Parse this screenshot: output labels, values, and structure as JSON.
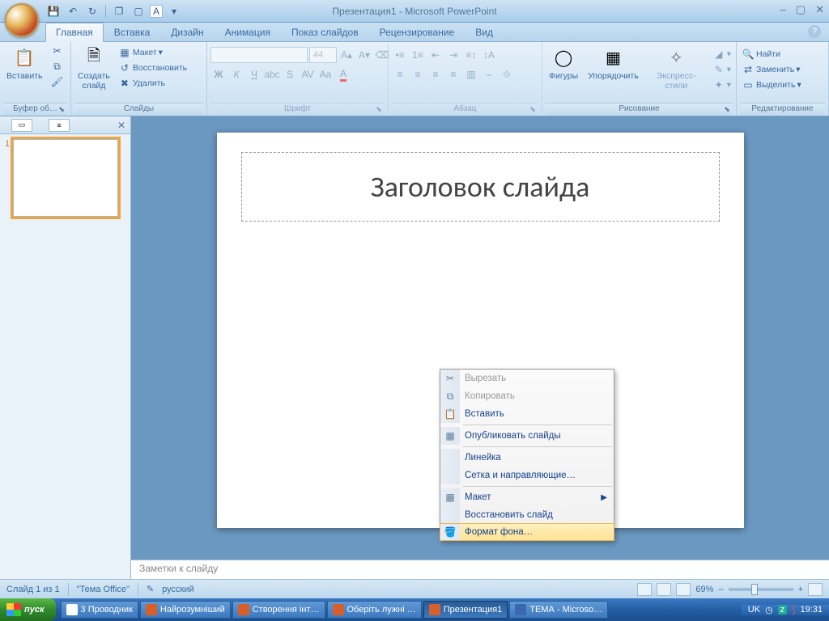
{
  "app_title": "Презентация1 - Microsoft PowerPoint",
  "qat": {
    "save": "💾",
    "undo": "↶",
    "redo": "↻",
    "new": "❐",
    "open": "▢",
    "a": "A"
  },
  "tabs": [
    "Главная",
    "Вставка",
    "Дизайн",
    "Анимация",
    "Показ слайдов",
    "Рецензирование",
    "Вид"
  ],
  "ribbon": {
    "clipboard": {
      "paste": "Вставить",
      "label": "Буфер об…"
    },
    "slides": {
      "new_slide": "Создать\nслайд",
      "layout": "Макет",
      "reset": "Восстановить",
      "delete": "Удалить",
      "label": "Слайды"
    },
    "font": {
      "size": "44",
      "label": "Шрифт"
    },
    "paragraph": {
      "label": "Абзац"
    },
    "drawing": {
      "shapes": "Фигуры",
      "arrange": "Упорядочить",
      "quick_styles": "Экспресс-стили",
      "label": "Рисование"
    },
    "editing": {
      "find": "Найти",
      "replace": "Заменить",
      "select": "Выделить",
      "label": "Редактирование"
    }
  },
  "slide": {
    "title_placeholder": "Заголовок слайда",
    "notes": "Заметки к слайду",
    "thumb_num": "1"
  },
  "ctx": {
    "cut": "Вырезать",
    "copy": "Копировать",
    "paste": "Вставить",
    "publish": "Опубликовать слайды",
    "ruler": "Линейка",
    "grid": "Сетка и направляющие…",
    "layout": "Макет",
    "reset": "Восстановить слайд",
    "format_bg": "Формат фона…"
  },
  "status": {
    "slide": "Слайд 1 из 1",
    "theme": "\"Тema Office\"",
    "lang": "русский",
    "zoom": "69%"
  },
  "status_correct": {
    "theme": "\"Тема Office\""
  },
  "taskbar": {
    "start": "пуск",
    "items": [
      {
        "label": "3 Проводник"
      },
      {
        "label": "Найрозумніший"
      },
      {
        "label": "Створення інт…"
      },
      {
        "label": "Оберіть лужні …"
      },
      {
        "label": "Презентация1",
        "active": true
      },
      {
        "label": "ТЕМА - Microso…"
      }
    ],
    "lang": "UK",
    "time": "19:31"
  }
}
